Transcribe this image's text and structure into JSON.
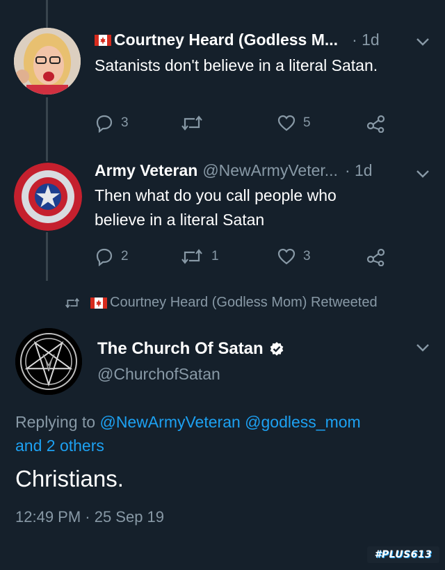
{
  "tweets": [
    {
      "name": "Courtney Heard (Godless M...",
      "time": "· 1d",
      "text_lines": [
        "Satanists don't believe in a literal Satan."
      ],
      "counts": {
        "reply": "3",
        "retweet": "",
        "like": "5"
      }
    },
    {
      "name": "Army Veteran",
      "handle": "@NewArmyVeter...",
      "time": "· 1d",
      "text_lines": [
        "Then what do you call people who",
        "believe in a literal Satan"
      ],
      "counts": {
        "reply": "2",
        "retweet": "1",
        "like": "3"
      }
    }
  ],
  "retweet_notice": "Courtney Heard (Godless Mom) Retweeted",
  "main_tweet": {
    "name": "The Church Of Satan",
    "handle": "@ChurchofSatan",
    "replying_prefix": "Replying to",
    "mention_1": "@NewArmyVeteran",
    "mention_2": "@godless_mom",
    "mention_3": "and 2 others",
    "text": "Christians.",
    "timestamp": "12:49 PM · 25 Sep 19"
  },
  "watermark": "#PLUS613",
  "colors": {
    "background": "#15202b",
    "secondary_text": "#8899a6",
    "link": "#1da1f2",
    "thread_line": "#38444d"
  },
  "icons": [
    "reply-icon",
    "retweet-icon",
    "like-icon",
    "share-icon",
    "verified-badge-icon",
    "chevron-down-icon",
    "canada-flag-icon"
  ]
}
